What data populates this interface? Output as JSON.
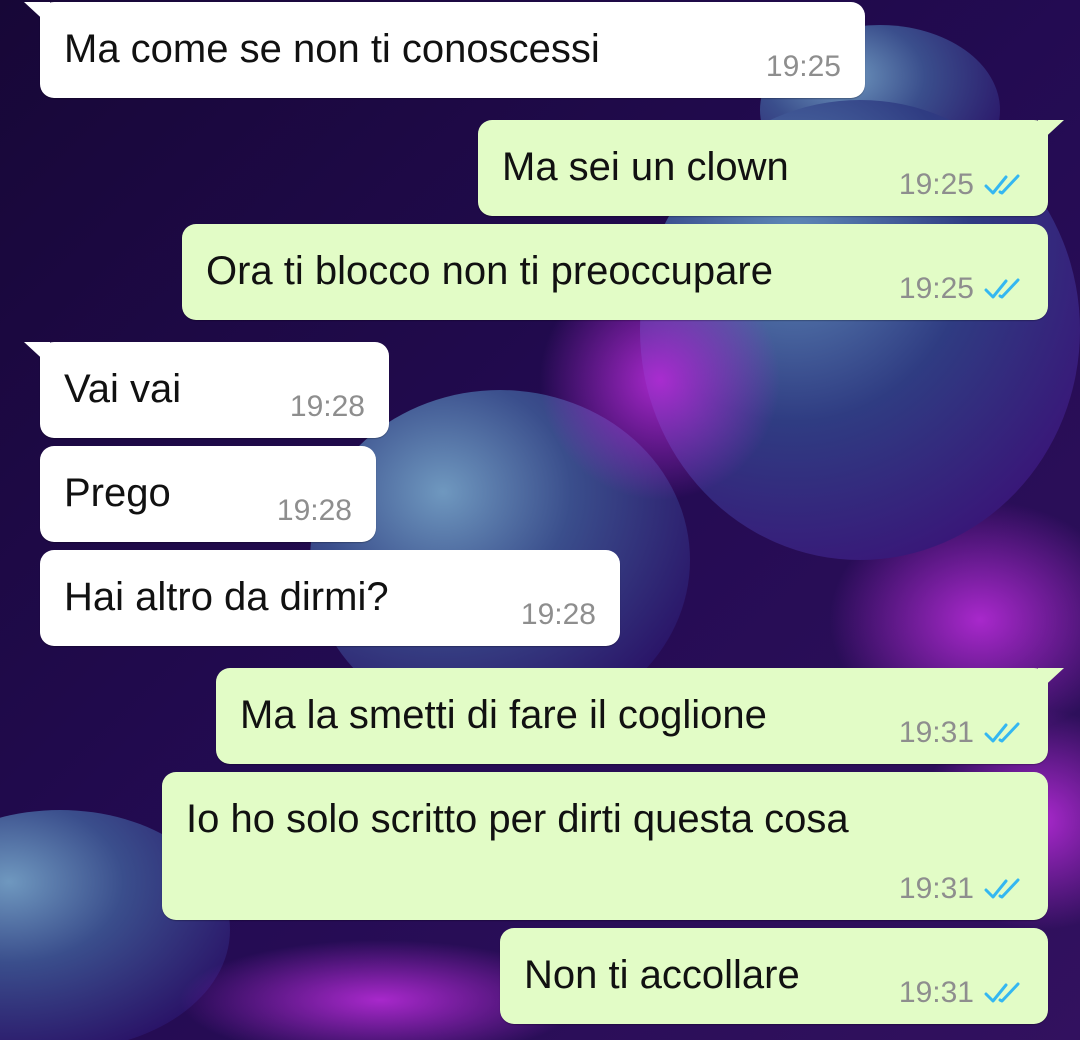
{
  "chat": {
    "messages": [
      {
        "direction": "incoming",
        "text": "Ma come se non ti conoscessi",
        "time": "19:25"
      },
      {
        "direction": "outgoing",
        "text": "Ma sei un clown",
        "time": "19:25",
        "status": "read"
      },
      {
        "direction": "outgoing",
        "text": "Ora ti blocco non ti preoccupare",
        "time": "19:25",
        "status": "read"
      },
      {
        "direction": "incoming",
        "text": "Vai vai",
        "time": "19:28"
      },
      {
        "direction": "incoming",
        "text": "Prego",
        "time": "19:28"
      },
      {
        "direction": "incoming",
        "text": "Hai altro da dirmi?",
        "time": "19:28"
      },
      {
        "direction": "outgoing",
        "text": "Ma la smetti di fare il coglione",
        "time": "19:31",
        "status": "read"
      },
      {
        "direction": "outgoing",
        "text": "Io ho solo scritto per dirti questa cosa",
        "time": "19:31",
        "status": "read"
      },
      {
        "direction": "outgoing",
        "text": "Non ti accollare",
        "time": "19:31",
        "status": "read"
      }
    ]
  },
  "colors": {
    "incoming_bubble": "#ffffff",
    "outgoing_bubble": "#e2fcc6",
    "read_ticks": "#34b7f1",
    "wallpaper_base": "#1e0a45"
  },
  "icons": {
    "read_status": "double-check-icon"
  }
}
